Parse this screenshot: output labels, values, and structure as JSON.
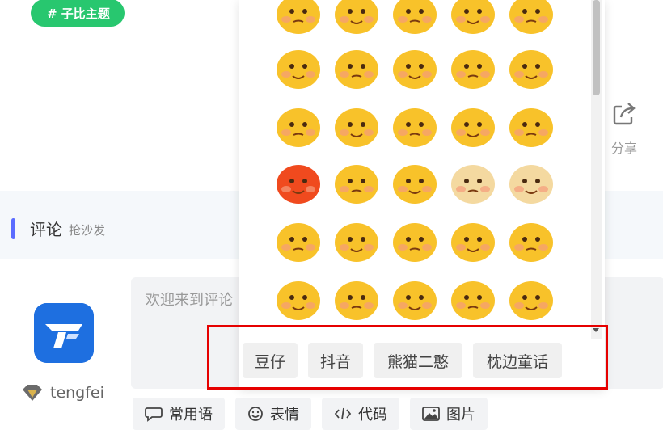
{
  "topic": {
    "label": "# 子比主题"
  },
  "comments": {
    "title": "评论",
    "subtitle": "抢沙发"
  },
  "editor": {
    "placeholder": "欢迎来到评论"
  },
  "user": {
    "name": "tengfei"
  },
  "toolbar": [
    {
      "label": "常用语",
      "icon": "chat-bubble-icon"
    },
    {
      "label": "表情",
      "icon": "smile-icon"
    },
    {
      "label": "代码",
      "icon": "code-icon"
    },
    {
      "label": "图片",
      "icon": "image-icon"
    }
  ],
  "share": {
    "label": "分享"
  },
  "emoji_panel": {
    "tabs": [
      "豆仔",
      "抖音",
      "熊猫二憨",
      "枕边童话"
    ]
  },
  "colors": {
    "accent_green": "#28c76f",
    "comment_bar": "#5b6cff",
    "highlight": "#e60000"
  }
}
